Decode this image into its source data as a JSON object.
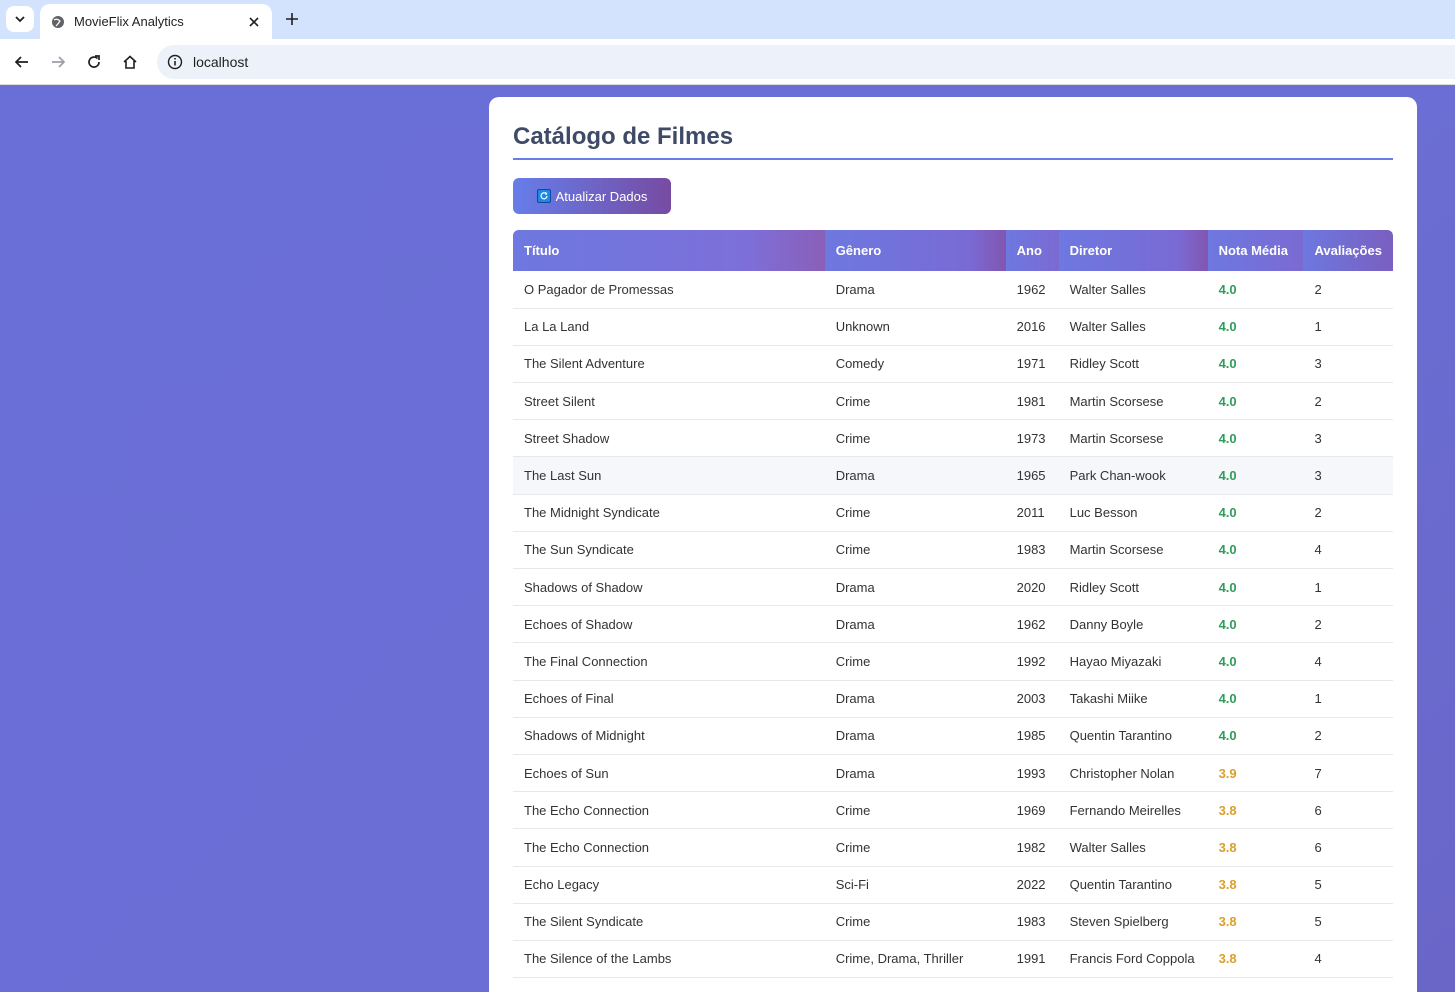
{
  "browser": {
    "tab_title": "MovieFlix Analytics",
    "url": "localhost"
  },
  "page": {
    "title": "Catálogo de Filmes",
    "refresh_label": "Atualizar Dados"
  },
  "colors": {
    "accent": "#667eea",
    "accent2": "#764ba2",
    "rating_high": "#2e9d5a",
    "rating_mid": "#d9a12b"
  },
  "table": {
    "headers": [
      "Título",
      "Gênero",
      "Ano",
      "Diretor",
      "Nota Média",
      "Avaliações"
    ],
    "rows": [
      [
        "O Pagador de Promessas",
        "Drama",
        "1962",
        "Walter Salles",
        "4.0",
        "2"
      ],
      [
        "La La Land",
        "Unknown",
        "2016",
        "Walter Salles",
        "4.0",
        "1"
      ],
      [
        "The Silent Adventure",
        "Comedy",
        "1971",
        "Ridley Scott",
        "4.0",
        "3"
      ],
      [
        "Street Silent",
        "Crime",
        "1981",
        "Martin Scorsese",
        "4.0",
        "2"
      ],
      [
        "Street Shadow",
        "Crime",
        "1973",
        "Martin Scorsese",
        "4.0",
        "3"
      ],
      [
        "The Last Sun",
        "Drama",
        "1965",
        "Park Chan-wook",
        "4.0",
        "3"
      ],
      [
        "The Midnight Syndicate",
        "Crime",
        "2011",
        "Luc Besson",
        "4.0",
        "2"
      ],
      [
        "The Sun Syndicate",
        "Crime",
        "1983",
        "Martin Scorsese",
        "4.0",
        "4"
      ],
      [
        "Shadows of Shadow",
        "Drama",
        "2020",
        "Ridley Scott",
        "4.0",
        "1"
      ],
      [
        "Echoes of Shadow",
        "Drama",
        "1962",
        "Danny Boyle",
        "4.0",
        "2"
      ],
      [
        "The Final Connection",
        "Crime",
        "1992",
        "Hayao Miyazaki",
        "4.0",
        "4"
      ],
      [
        "Echoes of Final",
        "Drama",
        "2003",
        "Takashi Miike",
        "4.0",
        "1"
      ],
      [
        "Shadows of Midnight",
        "Drama",
        "1985",
        "Quentin Tarantino",
        "4.0",
        "2"
      ],
      [
        "Echoes of Sun",
        "Drama",
        "1993",
        "Christopher Nolan",
        "3.9",
        "7"
      ],
      [
        "The Echo Connection",
        "Crime",
        "1969",
        "Fernando Meirelles",
        "3.8",
        "6"
      ],
      [
        "The Echo Connection",
        "Crime",
        "1982",
        "Walter Salles",
        "3.8",
        "6"
      ],
      [
        "Echo Legacy",
        "Sci-Fi",
        "2022",
        "Quentin Tarantino",
        "3.8",
        "5"
      ],
      [
        "The Silent Syndicate",
        "Crime",
        "1983",
        "Steven Spielberg",
        "3.8",
        "5"
      ],
      [
        "The Silence of the Lambs",
        "Crime, Drama, Thriller",
        "1991",
        "Francis Ford Coppola",
        "3.8",
        "4"
      ]
    ]
  }
}
